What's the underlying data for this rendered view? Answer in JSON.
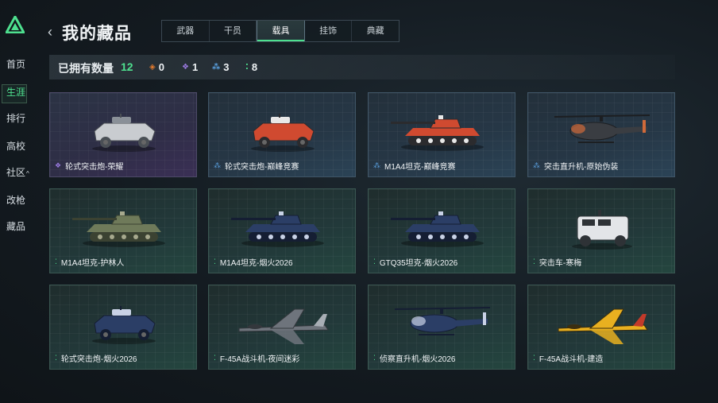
{
  "sidebar": {
    "items": [
      {
        "label": "首页"
      },
      {
        "label": "生涯"
      },
      {
        "label": "排行"
      },
      {
        "label": "高校"
      },
      {
        "label": "社区",
        "caret": "^"
      },
      {
        "label": "改枪"
      },
      {
        "label": "藏品"
      }
    ],
    "active_index": 1
  },
  "header": {
    "back_glyph": "‹",
    "title": "我的藏品",
    "tabs": [
      {
        "label": "武器"
      },
      {
        "label": "干员"
      },
      {
        "label": "载具"
      },
      {
        "label": "挂饰"
      },
      {
        "label": "典藏"
      }
    ],
    "active_tab_index": 2
  },
  "stats": {
    "label": "已拥有数量",
    "total": "12",
    "rarities": [
      {
        "icon": "orange-diamond-icon",
        "color": "#e07a2e",
        "count": "0"
      },
      {
        "icon": "purple-diamond-icon",
        "color": "#9a7ae0",
        "count": "1"
      },
      {
        "icon": "blue-triangle-icon",
        "color": "#5aa0e0",
        "count": "3"
      },
      {
        "icon": "green-dots-icon",
        "color": "#4ee08f",
        "count": "8"
      }
    ]
  },
  "colors": {
    "accent": "#4ee08f",
    "purple": "#9a7ae0",
    "blue": "#5aa0e0",
    "green": "#4ee08f"
  },
  "cards": [
    {
      "name": "轮式突击炮-荣耀",
      "rarity": "purple",
      "kind": "armored-car",
      "scheme": "light"
    },
    {
      "name": "轮式突击炮-巅峰竞赛",
      "rarity": "blue",
      "kind": "armored-car",
      "scheme": "red"
    },
    {
      "name": "M1A4坦克-巅峰竞赛",
      "rarity": "blue",
      "kind": "tank",
      "scheme": "red"
    },
    {
      "name": "突击直升机-原始伪装",
      "rarity": "blue",
      "kind": "helicopter",
      "scheme": "dark"
    },
    {
      "name": "M1A4坦克-护林人",
      "rarity": "green",
      "kind": "tank",
      "scheme": "camo"
    },
    {
      "name": "M1A4坦克-烟火2026",
      "rarity": "green",
      "kind": "tank",
      "scheme": "navy"
    },
    {
      "name": "GTQ35坦克-烟火2026",
      "rarity": "green",
      "kind": "tank",
      "scheme": "navy"
    },
    {
      "name": "突击车-寒梅",
      "rarity": "green",
      "kind": "truck",
      "scheme": "white"
    },
    {
      "name": "轮式突击炮-烟火2026",
      "rarity": "green",
      "kind": "armored-car",
      "scheme": "navy"
    },
    {
      "name": "F-45A战斗机-夜间迷彩",
      "rarity": "green",
      "kind": "jet",
      "scheme": "gray"
    },
    {
      "name": "侦察直升机-烟火2026",
      "rarity": "green",
      "kind": "helicopter",
      "scheme": "navy"
    },
    {
      "name": "F-45A战斗机-建造",
      "rarity": "green",
      "kind": "jet",
      "scheme": "yellow"
    }
  ]
}
